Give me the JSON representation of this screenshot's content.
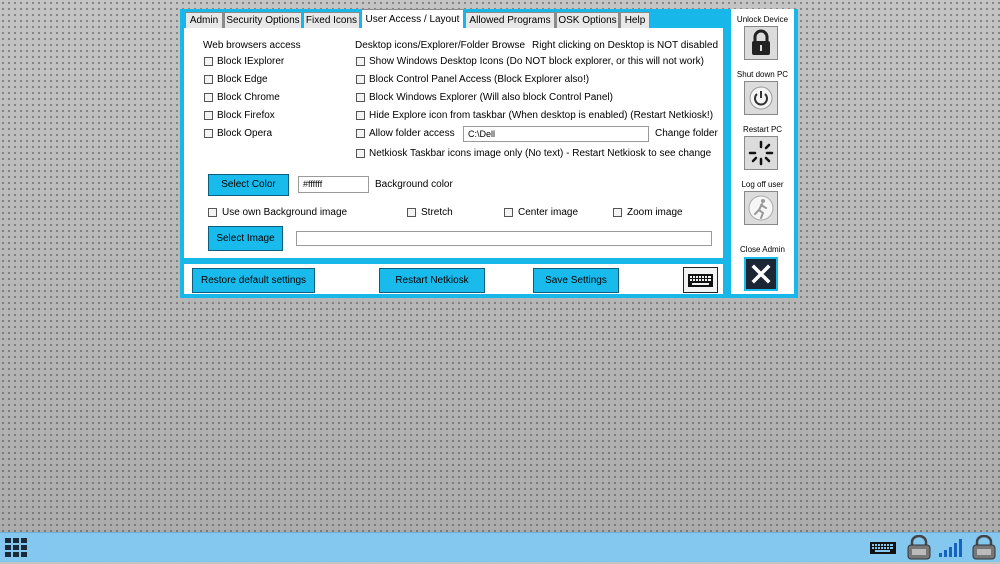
{
  "tabs": [
    {
      "label": "Admin",
      "active": false
    },
    {
      "label": "Security Options",
      "active": false
    },
    {
      "label": "Fixed Icons",
      "active": false
    },
    {
      "label": "User Access / Layout",
      "active": true
    },
    {
      "label": "Allowed Programs",
      "active": false
    },
    {
      "label": "OSK Options",
      "active": false
    },
    {
      "label": "Help",
      "active": false
    }
  ],
  "web_browsers": {
    "heading": "Web browsers access",
    "items": [
      {
        "label": "Block IExplorer",
        "checked": false
      },
      {
        "label": "Block Edge",
        "checked": false
      },
      {
        "label": "Block Chrome",
        "checked": false
      },
      {
        "label": "Block Firefox",
        "checked": false
      },
      {
        "label": "Block Opera",
        "checked": false
      }
    ]
  },
  "desktop": {
    "heading": "Desktop icons/Explorer/Folder Browse",
    "right_click_note": "Right clicking on Desktop is NOT disabled",
    "items": [
      {
        "label": "Show Windows Desktop Icons (Do NOT block explorer, or this will not work)",
        "checked": false
      },
      {
        "label": "Block Control Panel Access (Block Explorer also!)",
        "checked": false
      },
      {
        "label": "Block Windows Explorer (Will also block Control Panel)",
        "checked": false
      },
      {
        "label": "Hide Explore icon from taskbar (When desktop is enabled) (Restart Netkiosk!)",
        "checked": false
      },
      {
        "label": "Allow folder access",
        "checked": false
      },
      {
        "label": "Netkiosk Taskbar icons image only (No text)  - Restart Netkiosk to see change",
        "checked": false
      }
    ],
    "folder_value": "C:\\Dell",
    "change_folder_label": "Change folder"
  },
  "background": {
    "select_color_label": "Select Color",
    "color_value": "#ffffff",
    "color_caption": "Background color",
    "use_own_image_label": "Use own Background image",
    "stretch_label": "Stretch",
    "center_label": "Center image",
    "zoom_label": "Zoom image",
    "select_image_label": "Select Image",
    "image_path": ""
  },
  "bottom": {
    "restore_label": "Restore default settings",
    "restart_label": "Restart Netkiosk",
    "save_label": "Save Settings",
    "keyboard_icon": "keyboard-icon"
  },
  "side": {
    "unlock_label": "Unlock Device",
    "shutdown_label": "Shut down PC",
    "restart_label": "Restart PC",
    "logoff_label": "Log off user",
    "close_label": "Close Admin"
  },
  "taskbar": {
    "start_icon": "grid-icon",
    "tray_icons": [
      "keyboard-icon",
      "lock-icon",
      "signal-icon",
      "lock-icon"
    ]
  },
  "colors": {
    "accent": "#18b7ea",
    "button": "#19bbec",
    "taskbar": "#85c8ef"
  }
}
